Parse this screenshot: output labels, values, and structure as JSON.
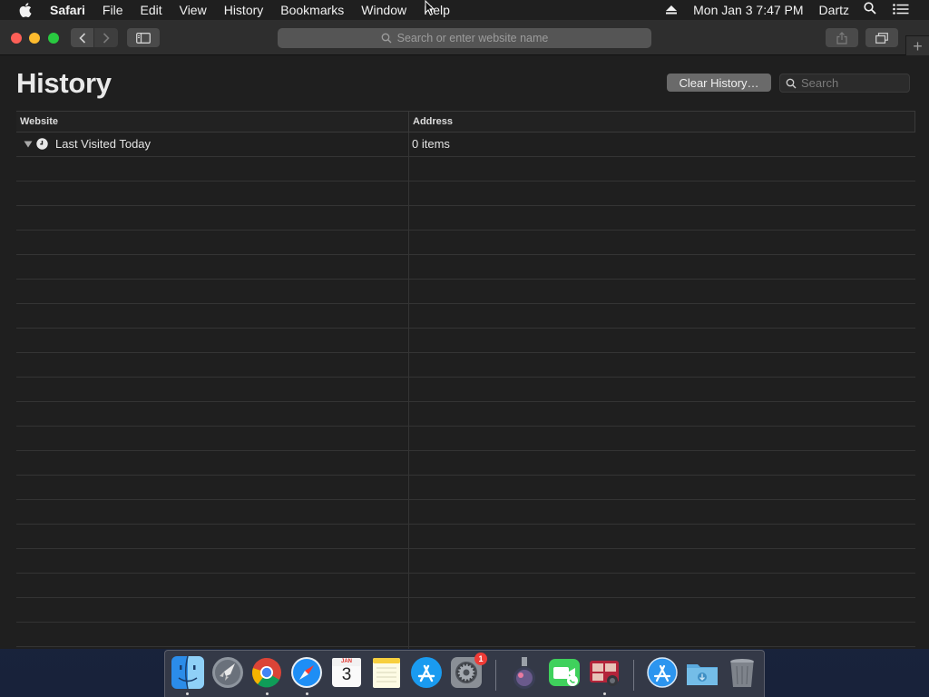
{
  "menubar": {
    "app_name": "Safari",
    "items": [
      "File",
      "Edit",
      "View",
      "History",
      "Bookmarks",
      "Window",
      "Help"
    ],
    "clock": "Mon Jan 3  7:47 PM",
    "user": "Dartz"
  },
  "toolbar": {
    "address_placeholder": "Search or enter website name",
    "new_tab": "+"
  },
  "history": {
    "title": "History",
    "clear_button": "Clear History…",
    "search_placeholder": "Search",
    "columns": {
      "website": "Website",
      "address": "Address"
    },
    "groups": [
      {
        "label": "Last Visited Today",
        "count": "0 items",
        "expanded": true
      }
    ]
  },
  "dock": {
    "apps": [
      "finder",
      "launchpad",
      "chrome",
      "safari",
      "calendar",
      "notes",
      "app-store",
      "system-preferences",
      "utility",
      "facetime",
      "photo-booth",
      "app-store-download",
      "downloads-folder",
      "trash"
    ],
    "calendar": {
      "month": "JAN",
      "day": "3"
    },
    "system_preferences_badge": "1"
  },
  "colors": {
    "close": "#fc5f57",
    "minimize": "#fdbb2e",
    "maximize": "#29c940",
    "window_bg": "#1f1f1f",
    "titlebar_bg": "#2e2e2e"
  }
}
